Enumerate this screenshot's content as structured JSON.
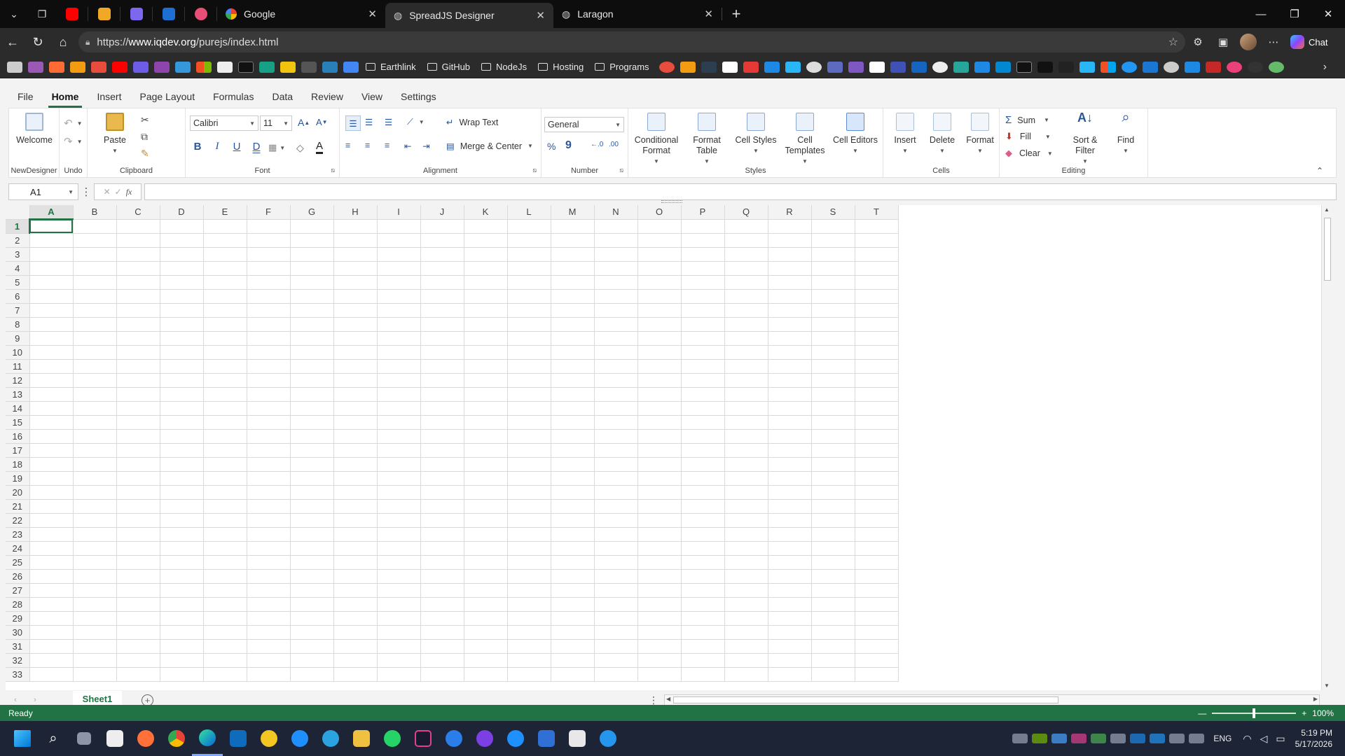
{
  "browser": {
    "tabs": [
      {
        "title": "Google",
        "active": false
      },
      {
        "title": "SpreadJS Designer",
        "active": true
      },
      {
        "title": "Laragon",
        "active": false
      }
    ],
    "url_prefix": "https://",
    "url_domain": "www.iqdev.org",
    "url_path": "/purejs/index.html",
    "chat_label": "Chat",
    "bookmark_folders": [
      "Earthlink",
      "GitHub",
      "NodeJs",
      "Hosting",
      "Programs"
    ]
  },
  "ribbon": {
    "tabs": [
      "File",
      "Home",
      "Insert",
      "Page Layout",
      "Formulas",
      "Data",
      "Review",
      "View",
      "Settings"
    ],
    "active_tab": "Home",
    "groups": {
      "newdesigner": {
        "label": "NewDesigner",
        "welcome": "Welcome"
      },
      "undo": {
        "label": "Undo"
      },
      "clipboard": {
        "label": "Clipboard",
        "paste": "Paste"
      },
      "font": {
        "label": "Font",
        "family": "Calibri",
        "size": "11",
        "bold": "B",
        "italic": "I",
        "underline": "U",
        "double_underline": "D"
      },
      "alignment": {
        "label": "Alignment",
        "wrap": "Wrap Text",
        "merge": "Merge & Center"
      },
      "number": {
        "label": "Number",
        "format": "General"
      },
      "styles": {
        "label": "Styles",
        "conditional_1": "Conditional",
        "conditional_2": "Format",
        "format_table_1": "Format",
        "format_table_2": "Table",
        "cell_styles": "Cell Styles",
        "cell_templates_1": "Cell",
        "cell_templates_2": "Templates",
        "cell_editors": "Cell Editors"
      },
      "cells": {
        "label": "Cells",
        "insert": "Insert",
        "delete": "Delete",
        "format": "Format"
      },
      "editing": {
        "label": "Editing",
        "sum": "Sum",
        "fill": "Fill",
        "clear": "Clear",
        "sort_1": "Sort &",
        "sort_2": "Filter",
        "find": "Find"
      }
    }
  },
  "formula_bar": {
    "name_box": "A1",
    "fx": "fx",
    "formula": ""
  },
  "sheet": {
    "columns": [
      "A",
      "B",
      "C",
      "D",
      "E",
      "F",
      "G",
      "H",
      "I",
      "J",
      "K",
      "L",
      "M",
      "N",
      "O",
      "P",
      "Q",
      "R",
      "S",
      "T"
    ],
    "row_count": 33,
    "active_cell": "A1",
    "tab_name": "Sheet1"
  },
  "status": {
    "text": "Ready",
    "zoom": "100%"
  },
  "taskbar": {
    "lang": "ENG",
    "time": "5:19 PM",
    "date": "5/17/2026"
  },
  "colors": {
    "accent": "#217346",
    "chrome_bg": "#0d0d0d",
    "taskbar_bg": "#1d2436"
  }
}
